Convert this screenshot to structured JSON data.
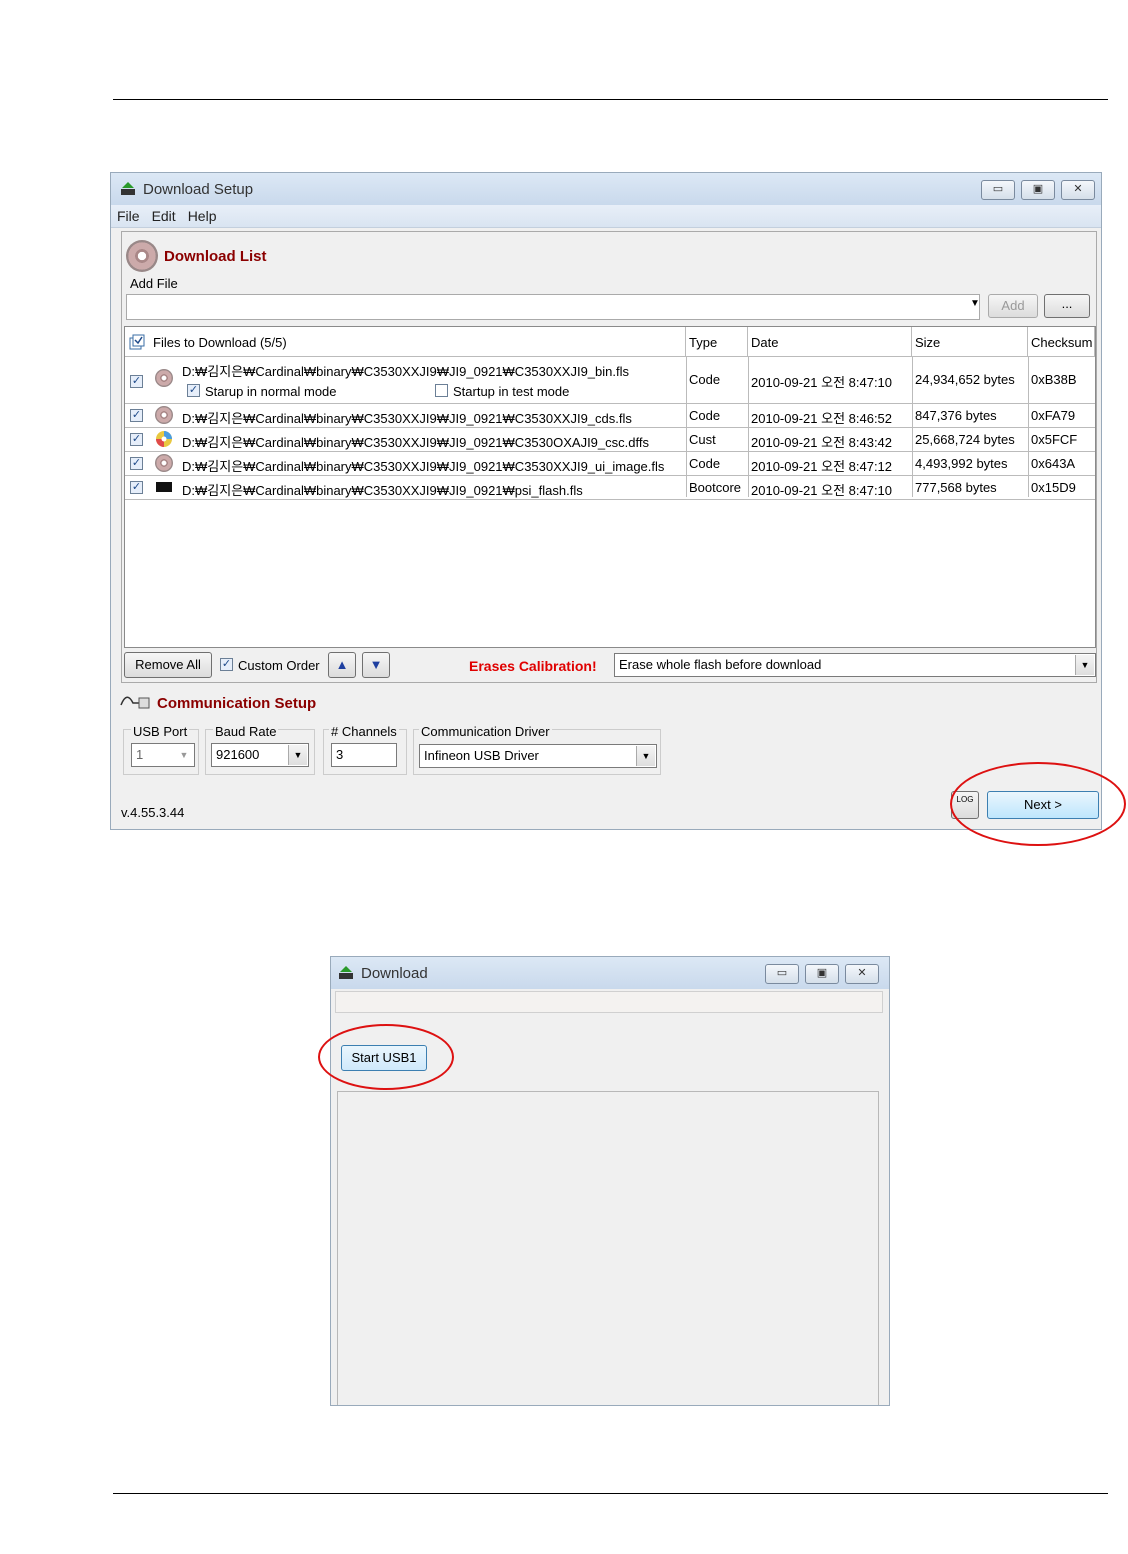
{
  "setup_window": {
    "title": "Download Setup",
    "menu": [
      "File",
      "Edit",
      "Help"
    ],
    "download_list_title": "Download List",
    "add_file_label": "Add File",
    "add_button": "Add",
    "browse_button": "...",
    "columns": [
      "Files to Download (5/5)",
      "Type",
      "Date",
      "Size",
      "Checksum"
    ],
    "files": [
      {
        "path": "D:₩김지은₩Cardinal₩binary₩C3530XXJI9₩JI9_0921₩C3530XXJI9_bin.fls",
        "type": "Code",
        "date": "2010-09-21 오전 8:47:10",
        "size": "24,934,652 bytes",
        "checksum": "0xB38B",
        "icon": "cd-icon"
      },
      {
        "path": "D:₩김지은₩Cardinal₩binary₩C3530XXJI9₩JI9_0921₩C3530XXJI9_cds.fls",
        "type": "Code",
        "date": "2010-09-21 오전 8:46:52",
        "size": "847,376 bytes",
        "checksum": "0xFA79",
        "icon": "cd-icon"
      },
      {
        "path": "D:₩김지은₩Cardinal₩binary₩C3530XXJI9₩JI9_0921₩C3530OXAJI9_csc.dffs",
        "type": "Cust",
        "date": "2010-09-21 오전 8:43:42",
        "size": "25,668,724 bytes",
        "checksum": "0x5FCF",
        "icon": "colorful-disc-icon"
      },
      {
        "path": "D:₩김지은₩Cardinal₩binary₩C3530XXJI9₩JI9_0921₩C3530XXJI9_ui_image.fls",
        "type": "Code",
        "date": "2010-09-21 오전 8:47:12",
        "size": "4,493,992 bytes",
        "checksum": "0x643A",
        "icon": "cd-icon"
      },
      {
        "path": "D:₩김지은₩Cardinal₩binary₩C3530XXJI9₩JI9_0921₩psi_flash.fls",
        "type": "Bootcore",
        "date": "2010-09-21 오전 8:47:10",
        "size": "777,568 bytes",
        "checksum": "0x15D9",
        "icon": "chip-icon"
      }
    ],
    "startup_normal": "Starup in normal mode",
    "startup_test": "Startup in test mode",
    "remove_all": "Remove All",
    "custom_order": "Custom Order",
    "erases_calibration": "Erases Calibration!",
    "erase_option": "Erase whole flash before download",
    "comm_title": "Communication Setup",
    "usb_port_label": "USB Port",
    "usb_port_value": "1",
    "baud_rate_label": "Baud Rate",
    "baud_rate_value": "921600",
    "channels_label": "# Channels",
    "channels_value": "3",
    "driver_label": "Communication Driver",
    "driver_value": "Infineon USB Driver",
    "version": "v.4.55.3.44",
    "log_icon_text": "LOG",
    "next_button": "Next >"
  },
  "download_window": {
    "title": "Download",
    "start_button": "Start USB1"
  },
  "colors": {
    "highlight_ellipse": "#dd1111",
    "section_title": "#8b0000",
    "erases_text": "#e00000"
  }
}
